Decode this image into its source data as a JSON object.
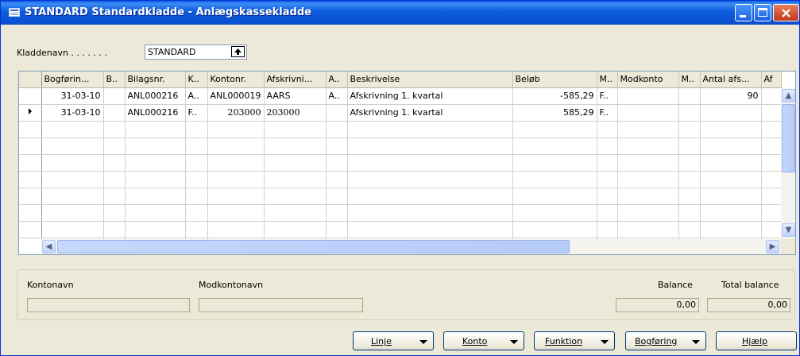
{
  "window": {
    "title": "STANDARD Standardkladde - Anlægskassekladde"
  },
  "header": {
    "kladdenavn_label": "Kladdenavn . . . . . . .",
    "kladdenavn_value": "STANDARD"
  },
  "grid": {
    "columns": [
      "Bogførin...",
      "B..",
      "Bilagsnr.",
      "K..",
      "Kontonr.",
      "Afskrivni...",
      "A..",
      "Beskrivelse",
      "Beløb",
      "M..",
      "Modkonto",
      "M..",
      "Antal afs...",
      "Af"
    ],
    "rows": [
      [
        "31-03-10",
        "",
        "ANL000216",
        "A..",
        "ANL000019",
        "AARS",
        "A..",
        "Afskrivning 1. kvartal",
        "-585,29",
        "F..",
        "",
        "",
        "90",
        ""
      ],
      [
        "31-03-10",
        "",
        "ANL000216",
        "F..",
        "203000",
        "203000",
        "",
        "Afskrivning 1. kvartal",
        "585,29",
        "F..",
        "",
        "",
        "",
        ""
      ]
    ]
  },
  "footer": {
    "kontonavn_label": "Kontonavn",
    "modkontonavn_label": "Modkontonavn",
    "balance_label": "Balance",
    "total_balance_label": "Total balance",
    "balance_value": "0,00",
    "total_balance_value": "0,00"
  },
  "buttons": {
    "linje": "Linje",
    "konto": "Konto",
    "funktion": "Funktion",
    "bogforing": "Bogføring",
    "hjaelp": "Hjælp"
  }
}
